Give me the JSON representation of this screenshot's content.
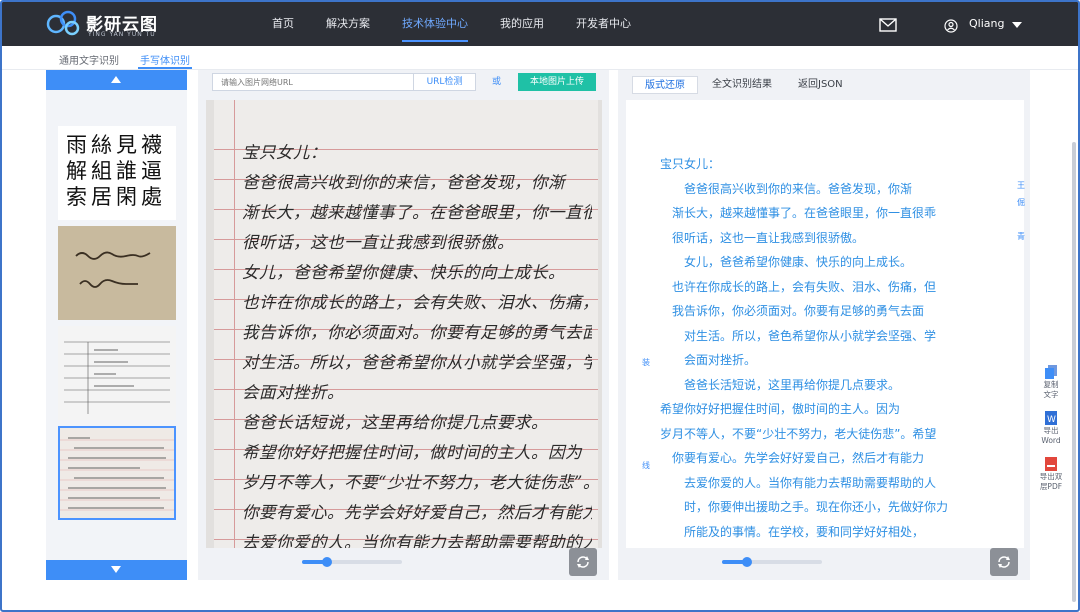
{
  "brand": {
    "name": "影研云图",
    "sub": "YING YAN YUN TU",
    "accent": "#3e8ef7"
  },
  "nav": {
    "items": [
      {
        "label": "首页",
        "active": false
      },
      {
        "label": "解决方案",
        "active": false
      },
      {
        "label": "技术体验中心",
        "active": true
      },
      {
        "label": "我的应用",
        "active": false
      },
      {
        "label": "开发者中心",
        "active": false
      }
    ],
    "user_name": "Qliang",
    "icons": [
      "mail-icon",
      "user-icon",
      "caret-down-icon"
    ]
  },
  "subtabs": [
    {
      "label": "通用文字识别",
      "active": false
    },
    {
      "label": "手写体识别",
      "active": true
    }
  ],
  "image_panel": {
    "url_placeholder": "请输入图片网络URL",
    "url_button": "URL检测",
    "or_label": "或",
    "upload_button": "本地图片上传",
    "handwriting_lines": [
      "宝只女儿：",
      "  爸爸很高兴收到你的来信，爸爸发现，你渐",
      "渐长大，越来越懂事了。在爸爸眼里，你一直很乖",
      "很听话，这也一直让我感到很骄傲。",
      "  女儿，爸爸希望你健康、快乐的向上成长。",
      "也许在你成长的路上，会有失败、泪水、伤痛，但",
      "我告诉你，你必须面对。你要有足够的勇气去面",
      "对生活。所以，爸爸希望你从小就学会坚强，学",
      "会面对挫折。",
      "  爸爸长话短说，这里再给你提几点要求。",
      "希望你好好把握住时间，做时间的主人。因为",
      "岁月不等人，不要“少壮不努力，老大徒伤悲”。希望",
      "你要有爱心。先学会好好爱自己，然后才有能力",
      "去爱你爱的人。当你有能力去帮助需要帮助的人",
      "时，你要伸出援助之手。现在你还小，先做好你力",
      "所能及的事情。在学校，要和同学好好相处，"
    ]
  },
  "result_panel": {
    "tabs": [
      {
        "label": "版式还原",
        "active": true
      },
      {
        "label": "全文识别结果",
        "active": false
      },
      {
        "label": "返回JSON",
        "active": false
      }
    ],
    "lines": [
      "宝只女儿：",
      "　　爸爸很高兴收到你的来信。爸爸发现，你渐",
      "　渐长大，越来越懂事了。在爸爸眼里，你一直很乖",
      "　很听话，这也一直让我感到很骄傲。",
      "　　女儿，爸爸希望你健康、快乐的向上成长。",
      "　也许在你成长的路上，会有失败、泪水、伤痛，但",
      "　我告诉你，你必须面对。你要有足够的勇气去面",
      "　　对生活。所以，爸色希望你从小就学会坚强、学",
      "　　会面对挫折。",
      "　　爸爸长活短说，这里再给你提几点要求。",
      "希望你好好把握住时间，傲时间的主人。因为",
      "岁月不等人，不要“少壮不努力，老大徒伤悲”。希望",
      "　你要有爱心。先学会好好爱自己，然后才有能力",
      "　　去爱你爱的人。当你有能力去帮助需要帮助的人",
      "　　时，你要伸出援助之手。现在你还小，先做好你力",
      "　　所能及的事情。在学校，要和同学好好相处，"
    ],
    "side_marks": [
      "装",
      "线",
      "王",
      "倔",
      "青"
    ]
  },
  "tools": [
    {
      "label_1": "复制",
      "label_2": "文字",
      "icon": "copy-icon"
    },
    {
      "label_1": "导出",
      "label_2": "Word",
      "icon": "word-icon"
    },
    {
      "label_1": "导出双",
      "label_2": "层PDF",
      "icon": "pdf-icon"
    }
  ]
}
